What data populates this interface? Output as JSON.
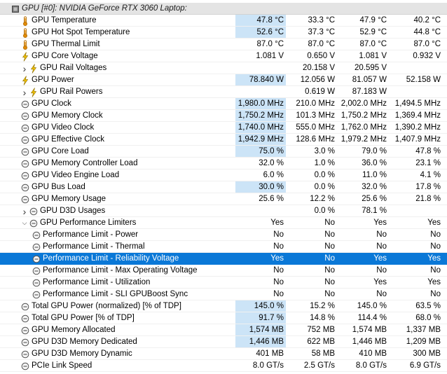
{
  "device": {
    "title": "GPU [#0]: NVIDIA GeForce RTX 3060 Laptop:"
  },
  "colors": {
    "highlight": "#cce4f7",
    "selected": "#0a78d7",
    "header": "#e4e4e4"
  },
  "rows": [
    {
      "label": "GPU Temperature",
      "icon": "thermometer-icon",
      "indent": 0,
      "values": [
        "47.8 °C",
        "33.3 °C",
        "47.9 °C",
        "40.2 °C"
      ],
      "hl": true
    },
    {
      "label": "GPU Hot Spot Temperature",
      "icon": "thermometer-icon",
      "indent": 0,
      "values": [
        "52.6 °C",
        "37.3 °C",
        "52.9 °C",
        "44.8 °C"
      ],
      "hl": true
    },
    {
      "label": "GPU Thermal Limit",
      "icon": "thermometer-icon",
      "indent": 0,
      "values": [
        "87.0 °C",
        "87.0 °C",
        "87.0 °C",
        "87.0 °C"
      ]
    },
    {
      "label": "GPU Core Voltage",
      "icon": "lightning-icon",
      "indent": 0,
      "values": [
        "1.081 V",
        "0.650 V",
        "1.081 V",
        "0.932 V"
      ]
    },
    {
      "label": "GPU Rail Voltages",
      "icon": "lightning-icon",
      "indent": 1,
      "expander": "collapsed",
      "values": [
        "",
        "20.158 V",
        "20.595 V",
        ""
      ]
    },
    {
      "label": "GPU Power",
      "icon": "lightning-icon",
      "indent": 0,
      "values": [
        "78.840 W",
        "12.056 W",
        "81.057 W",
        "52.158 W"
      ],
      "hl": true
    },
    {
      "label": "GPU Rail Powers",
      "icon": "lightning-icon",
      "indent": 1,
      "expander": "collapsed",
      "values": [
        "",
        "0.619 W",
        "87.183 W",
        ""
      ]
    },
    {
      "label": "GPU Clock",
      "icon": "clock-icon",
      "indent": 0,
      "values": [
        "1,980.0 MHz",
        "210.0 MHz",
        "2,002.0 MHz",
        "1,494.5 MHz"
      ],
      "hl": true
    },
    {
      "label": "GPU Memory Clock",
      "icon": "clock-icon",
      "indent": 0,
      "values": [
        "1,750.2 MHz",
        "101.3 MHz",
        "1,750.2 MHz",
        "1,369.4 MHz"
      ],
      "hl": true
    },
    {
      "label": "GPU Video Clock",
      "icon": "clock-icon",
      "indent": 0,
      "values": [
        "1,740.0 MHz",
        "555.0 MHz",
        "1,762.0 MHz",
        "1,390.2 MHz"
      ],
      "hl": true
    },
    {
      "label": "GPU Effective Clock",
      "icon": "clock-icon",
      "indent": 0,
      "values": [
        "1,942.9 MHz",
        "128.6 MHz",
        "1,979.2 MHz",
        "1,407.9 MHz"
      ],
      "hl": true
    },
    {
      "label": "GPU Core Load",
      "icon": "clock-icon",
      "indent": 0,
      "values": [
        "75.0 %",
        "3.0 %",
        "79.0 %",
        "47.8 %"
      ],
      "hl": true
    },
    {
      "label": "GPU Memory Controller Load",
      "icon": "clock-icon",
      "indent": 0,
      "values": [
        "32.0 %",
        "1.0 %",
        "36.0 %",
        "23.1 %"
      ]
    },
    {
      "label": "GPU Video Engine Load",
      "icon": "clock-icon",
      "indent": 0,
      "values": [
        "6.0 %",
        "0.0 %",
        "11.0 %",
        "4.1 %"
      ]
    },
    {
      "label": "GPU Bus Load",
      "icon": "clock-icon",
      "indent": 0,
      "values": [
        "30.0 %",
        "0.0 %",
        "32.0 %",
        "17.8 %"
      ],
      "hl": true
    },
    {
      "label": "GPU Memory Usage",
      "icon": "clock-icon",
      "indent": 0,
      "values": [
        "25.6 %",
        "12.2 %",
        "25.6 %",
        "21.8 %"
      ]
    },
    {
      "label": "GPU D3D Usages",
      "icon": "clock-icon",
      "indent": 1,
      "expander": "collapsed",
      "values": [
        "",
        "0.0 %",
        "78.1 %",
        ""
      ]
    },
    {
      "label": "GPU Performance Limiters",
      "icon": "clock-icon",
      "indent": 1,
      "expander": "expanded",
      "values": [
        "Yes",
        "No",
        "Yes",
        "Yes"
      ]
    },
    {
      "label": "Performance Limit - Power",
      "icon": "clock-icon",
      "indent": 2,
      "values": [
        "No",
        "No",
        "No",
        "No"
      ]
    },
    {
      "label": "Performance Limit - Thermal",
      "icon": "clock-icon",
      "indent": 2,
      "values": [
        "No",
        "No",
        "No",
        "No"
      ]
    },
    {
      "label": "Performance Limit - Reliability Voltage",
      "icon": "clock-icon",
      "indent": 2,
      "values": [
        "Yes",
        "No",
        "Yes",
        "Yes"
      ],
      "selected": true
    },
    {
      "label": "Performance Limit - Max Operating Voltage",
      "icon": "clock-icon",
      "indent": 2,
      "values": [
        "No",
        "No",
        "No",
        "No"
      ]
    },
    {
      "label": "Performance Limit - Utilization",
      "icon": "clock-icon",
      "indent": 2,
      "values": [
        "No",
        "No",
        "Yes",
        "Yes"
      ]
    },
    {
      "label": "Performance Limit - SLI GPUBoost Sync",
      "icon": "clock-icon",
      "indent": 2,
      "values": [
        "No",
        "No",
        "No",
        "No"
      ]
    },
    {
      "label": "Total GPU Power (normalized) [% of TDP]",
      "icon": "clock-icon",
      "indent": 0,
      "values": [
        "145.0 %",
        "15.2 %",
        "145.0 %",
        "63.5 %"
      ],
      "hl": true
    },
    {
      "label": "Total GPU Power [% of TDP]",
      "icon": "clock-icon",
      "indent": 0,
      "values": [
        "91.7 %",
        "14.8 %",
        "114.4 %",
        "68.0 %"
      ],
      "hl": true
    },
    {
      "label": "GPU Memory Allocated",
      "icon": "clock-icon",
      "indent": 0,
      "values": [
        "1,574 MB",
        "752 MB",
        "1,574 MB",
        "1,337 MB"
      ],
      "hl": true
    },
    {
      "label": "GPU D3D Memory Dedicated",
      "icon": "clock-icon",
      "indent": 0,
      "values": [
        "1,446 MB",
        "622 MB",
        "1,446 MB",
        "1,209 MB"
      ],
      "hl": true
    },
    {
      "label": "GPU D3D Memory Dynamic",
      "icon": "clock-icon",
      "indent": 0,
      "values": [
        "401 MB",
        "58 MB",
        "410 MB",
        "300 MB"
      ]
    },
    {
      "label": "PCIe Link Speed",
      "icon": "clock-icon",
      "indent": 0,
      "values": [
        "8.0 GT/s",
        "2.5 GT/s",
        "8.0 GT/s",
        "6.9 GT/s"
      ]
    }
  ]
}
